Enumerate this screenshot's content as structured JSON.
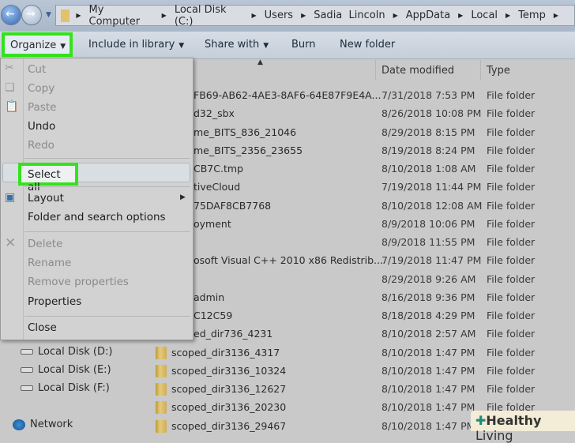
{
  "breadcrumb": [
    "My Computer",
    "Local Disk (C:)",
    "Users",
    "Sadia  Lincoln",
    "AppData",
    "Local",
    "Temp"
  ],
  "toolbar": {
    "organize": "Organize",
    "include": "Include in library",
    "share": "Share with",
    "burn": "Burn",
    "new_folder": "New folder"
  },
  "columns": {
    "date": "Date modified",
    "type": "Type"
  },
  "files": [
    {
      "name": "FB69-AB62-4AE3-8AF6-64E87F9E4A...",
      "date": "7/31/2018 7:53 PM",
      "type": "File folder"
    },
    {
      "name": "d32_sbx",
      "date": "8/26/2018 10:08 PM",
      "type": "File folder"
    },
    {
      "name": "me_BITS_836_21046",
      "date": "8/29/2018 8:15 PM",
      "type": "File folder"
    },
    {
      "name": "me_BITS_2356_23655",
      "date": "8/19/2018 8:24 PM",
      "type": "File folder"
    },
    {
      "name": "CB7C.tmp",
      "date": "8/10/2018 1:08 AM",
      "type": "File folder"
    },
    {
      "name": "tiveCloud",
      "date": "7/19/2018 11:44 PM",
      "type": "File folder"
    },
    {
      "name": "75DAF8CB7768",
      "date": "8/10/2018 12:08 AM",
      "type": "File folder"
    },
    {
      "name": "oyment",
      "date": "8/9/2018 10:06 PM",
      "type": "File folder"
    },
    {
      "name": "",
      "date": "8/9/2018 11:55 PM",
      "type": "File folder"
    },
    {
      "name": "osoft Visual C++ 2010  x86 Redistrib...",
      "date": "7/19/2018 11:47 PM",
      "type": "File folder"
    },
    {
      "name": "",
      "date": "8/29/2018 9:26 AM",
      "type": "File folder"
    },
    {
      "name": "admin",
      "date": "8/16/2018 9:36 PM",
      "type": "File folder"
    },
    {
      "name": "C12C59",
      "date": "8/18/2018 4:29 PM",
      "type": "File folder"
    },
    {
      "name": "ed_dir736_4231",
      "date": "8/10/2018 2:57 AM",
      "type": "File folder"
    },
    {
      "name": "scoped_dir3136_4317",
      "date": "8/10/2018 1:47 PM",
      "type": "File folder"
    },
    {
      "name": "scoped_dir3136_10324",
      "date": "8/10/2018 1:47 PM",
      "type": "File folder"
    },
    {
      "name": "scoped_dir3136_12627",
      "date": "8/10/2018 1:47 PM",
      "type": "File folder"
    },
    {
      "name": "scoped_dir3136_20230",
      "date": "8/10/2018 1:47 PM",
      "type": "File folder"
    },
    {
      "name": "scoped_dir3136_29467",
      "date": "8/10/2018 1:47 PM",
      "type": ""
    }
  ],
  "nav": [
    "Local Disk (D:)",
    "Local Disk (E:)",
    "Local Disk (F:)",
    "Network"
  ],
  "menu": {
    "cut": "Cut",
    "copy": "Copy",
    "paste": "Paste",
    "undo": "Undo",
    "redo": "Redo",
    "select_all": "Select all",
    "layout": "Layout",
    "folder_options": "Folder and search options",
    "delete": "Delete",
    "rename": "Rename",
    "remove_properties": "Remove properties",
    "properties": "Properties",
    "close": "Close"
  },
  "watermark": {
    "brand": "Healthy",
    "suffix": "Living"
  },
  "colors": {
    "highlight": "#33e31b"
  }
}
